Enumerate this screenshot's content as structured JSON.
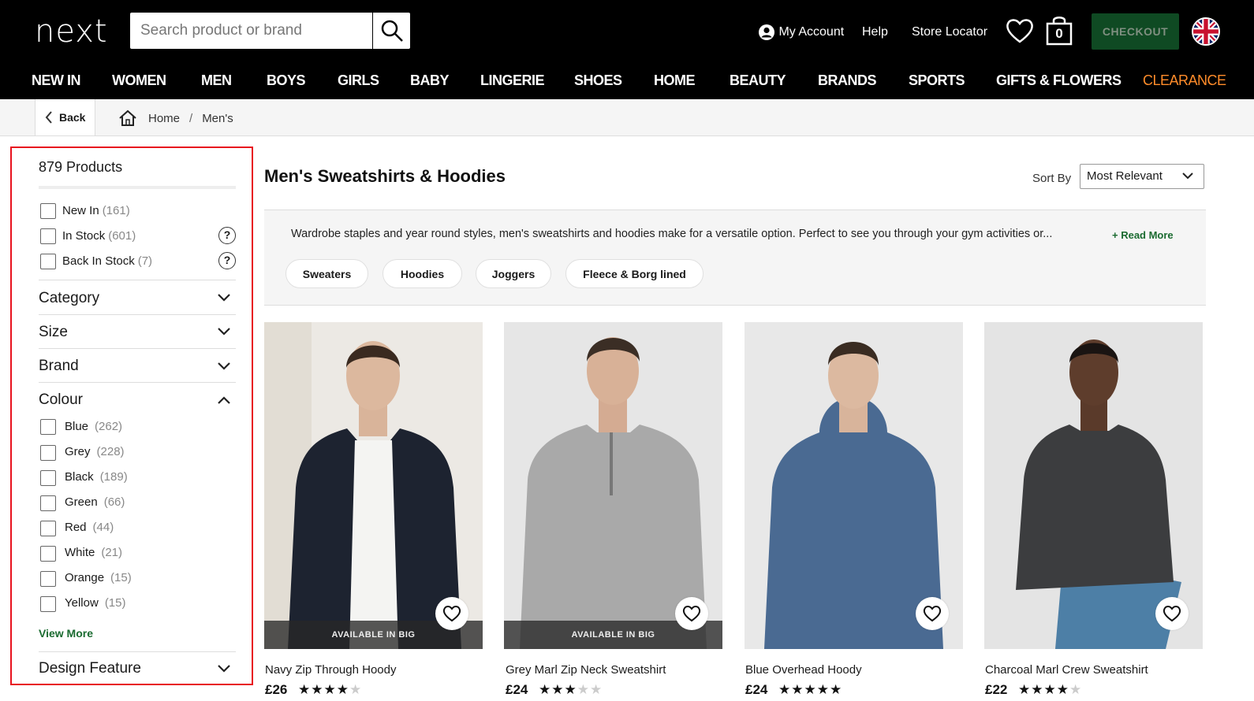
{
  "header": {
    "logo": "next",
    "search_placeholder": "Search product or brand",
    "my_account": "My Account",
    "help": "Help",
    "store_locator": "Store Locator",
    "bag_count": "0",
    "checkout": "CHECKOUT"
  },
  "nav": [
    "NEW IN",
    "WOMEN",
    "MEN",
    "BOYS",
    "GIRLS",
    "BABY",
    "LINGERIE",
    "SHOES",
    "HOME",
    "BEAUTY",
    "BRANDS",
    "SPORTS",
    "GIFTS & FLOWERS",
    "CLEARANCE"
  ],
  "breadcrumb": {
    "back": "Back",
    "home": "Home",
    "sep": "/",
    "current": "Men's"
  },
  "filters": {
    "product_count": "879 Products",
    "quick": [
      {
        "label": "New In",
        "count": "(161)"
      },
      {
        "label": "In Stock",
        "count": "(601)"
      },
      {
        "label": "Back In Stock",
        "count": "(7)"
      }
    ],
    "help_icon": "?",
    "sections": [
      "Category",
      "Size",
      "Brand",
      "Colour"
    ],
    "colours": [
      {
        "label": "Blue",
        "count": "(262)"
      },
      {
        "label": "Grey",
        "count": "(228)"
      },
      {
        "label": "Black",
        "count": "(189)"
      },
      {
        "label": "Green",
        "count": "(66)"
      },
      {
        "label": "Red",
        "count": "(44)"
      },
      {
        "label": "White",
        "count": "(21)"
      },
      {
        "label": "Orange",
        "count": "(15)"
      },
      {
        "label": "Yellow",
        "count": "(15)"
      }
    ],
    "view_more": "View More",
    "design_feature": "Design Feature"
  },
  "main": {
    "title": "Men's Sweatshirts & Hoodies",
    "sort_label": "Sort By",
    "sort_value": "Most Relevant",
    "description": "Wardrobe staples and year round styles, men's sweatshirts and hoodies make for a versatile option. Perfect to see you through your gym activities or...",
    "read_more": "+ Read More",
    "pills": [
      "Sweaters",
      "Hoodies",
      "Joggers",
      "Fleece & Borg lined"
    ]
  },
  "products": [
    {
      "name": "Navy Zip Through Hoody",
      "price": "£26",
      "badge": "AVAILABLE IN BIG",
      "rating": 4,
      "garment": "#1d2330"
    },
    {
      "name": "Grey Marl Zip Neck Sweatshirt",
      "price": "£24",
      "badge": "AVAILABLE IN BIG",
      "rating": 3,
      "garment": "#a9a9a9"
    },
    {
      "name": "Blue Overhead Hoody",
      "price": "£24",
      "badge": "",
      "rating": 5,
      "garment": "#4a6a92"
    },
    {
      "name": "Charcoal Marl Crew Sweatshirt",
      "price": "£22",
      "badge": "",
      "rating": 4,
      "garment": "#3c3d3f"
    }
  ],
  "colors": {
    "checkout_bg": "#0f4a23",
    "clearance": "#ff8c2a",
    "filter_border": "#e8121e",
    "link_green": "#1a6b30"
  }
}
